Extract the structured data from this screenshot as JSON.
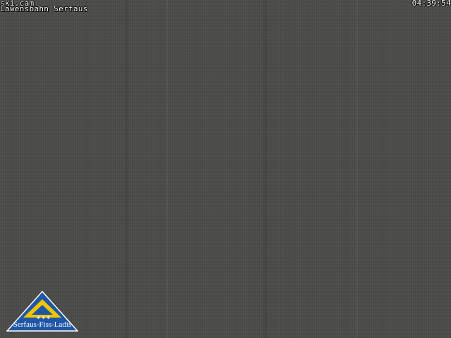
{
  "overlay": {
    "site": "ski.cam",
    "location": "Lawensbahn Serfaus",
    "time": "04:39:54"
  },
  "logo": {
    "text": "Serfaus-Fiss-Ladis",
    "colors": {
      "triangle_outer": "#1f57a6",
      "triangle_inner": "#f2c500",
      "snowflakes": "#ffffff"
    }
  },
  "image": {
    "scene": "dark webcam frame",
    "background_color": "#4b4b48"
  }
}
